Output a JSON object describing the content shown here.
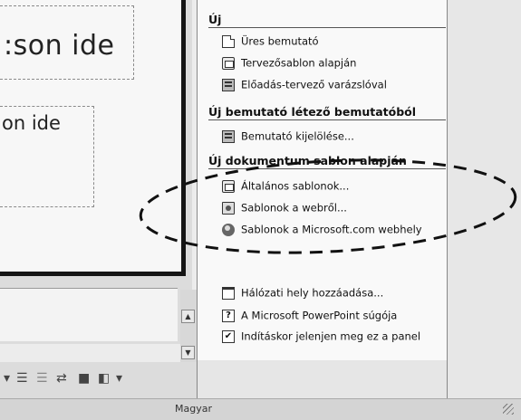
{
  "slide": {
    "title_text": ":son ide",
    "body_text": "on ide"
  },
  "task_pane": {
    "section_new": "Új",
    "new_items": [
      {
        "label": "Üres bemutató",
        "icon": "blank-doc-icon"
      },
      {
        "label": "Tervezősablon alapján",
        "icon": "design-template-icon"
      },
      {
        "label": "Előadás-tervező varázslóval",
        "icon": "wizard-icon"
      }
    ],
    "section_existing": "Új bemutató létező bemutatóból",
    "existing_items": [
      {
        "label": "Bemutató kijelölése...",
        "icon": "choose-presentation-icon"
      }
    ],
    "section_template": "Új dokumentum sablon alapján",
    "template_items": [
      {
        "label": "Általános sablonok...",
        "icon": "general-templates-icon"
      },
      {
        "label": "Sablonok a webről...",
        "icon": "web-templates-icon"
      },
      {
        "label": "Sablonok a Microsoft.com webhely",
        "icon": "microsoft-com-icon"
      }
    ],
    "bottom_items": [
      {
        "label": "Hálózati hely hozzáadása...",
        "icon": "network-place-icon"
      },
      {
        "label": "A Microsoft PowerPoint súgója",
        "icon": "help-icon"
      },
      {
        "label": "Indításkor jelenjen meg ez a panel",
        "icon": "checkbox-icon",
        "checked": true
      }
    ]
  },
  "statusbar": {
    "language": "Magyar"
  },
  "help_glyph": "?",
  "check_glyph": "✔"
}
